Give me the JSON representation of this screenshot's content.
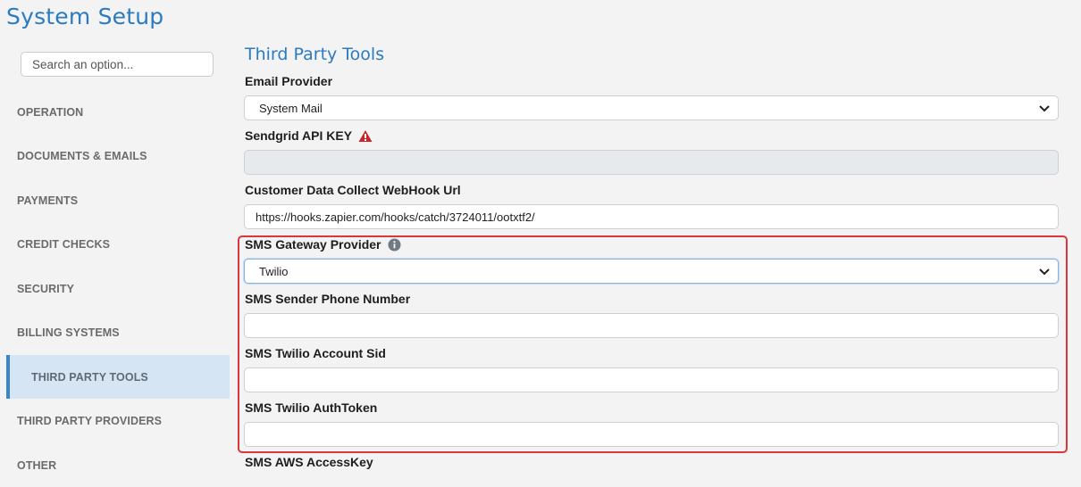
{
  "page": {
    "title": "System Setup"
  },
  "sidebar": {
    "search_placeholder": "Search an option...",
    "items": [
      {
        "label": "OPERATION"
      },
      {
        "label": "DOCUMENTS & EMAILS"
      },
      {
        "label": "PAYMENTS"
      },
      {
        "label": "CREDIT CHECKS"
      },
      {
        "label": "SECURITY"
      },
      {
        "label": "BILLING SYSTEMS"
      },
      {
        "label": "THIRD PARTY TOOLS",
        "active": true
      },
      {
        "label": "THIRD PARTY PROVIDERS"
      },
      {
        "label": "OTHER"
      }
    ]
  },
  "main": {
    "section_title": "Third Party Tools",
    "email_provider": {
      "label": "Email Provider",
      "value": "System Mail"
    },
    "sendgrid": {
      "label": "Sendgrid API KEY",
      "value": ""
    },
    "webhook": {
      "label": "Customer Data Collect WebHook Url",
      "value": "https://hooks.zapier.com/hooks/catch/3724011/ootxtf2/"
    },
    "sms_gateway": {
      "label": "SMS Gateway Provider",
      "value": "Twilio"
    },
    "sms_sender": {
      "label": "SMS Sender Phone Number",
      "value": ""
    },
    "twilio_sid": {
      "label": "SMS Twilio Account Sid",
      "value": ""
    },
    "twilio_token": {
      "label": "SMS Twilio AuthToken",
      "value": ""
    },
    "aws_key": {
      "label": "SMS AWS AccessKey"
    }
  },
  "colors": {
    "accent": "#2b7bc1",
    "highlight": "#d9363e",
    "warning": "#c9252c",
    "active_nav_bg": "#d6e5f3"
  }
}
